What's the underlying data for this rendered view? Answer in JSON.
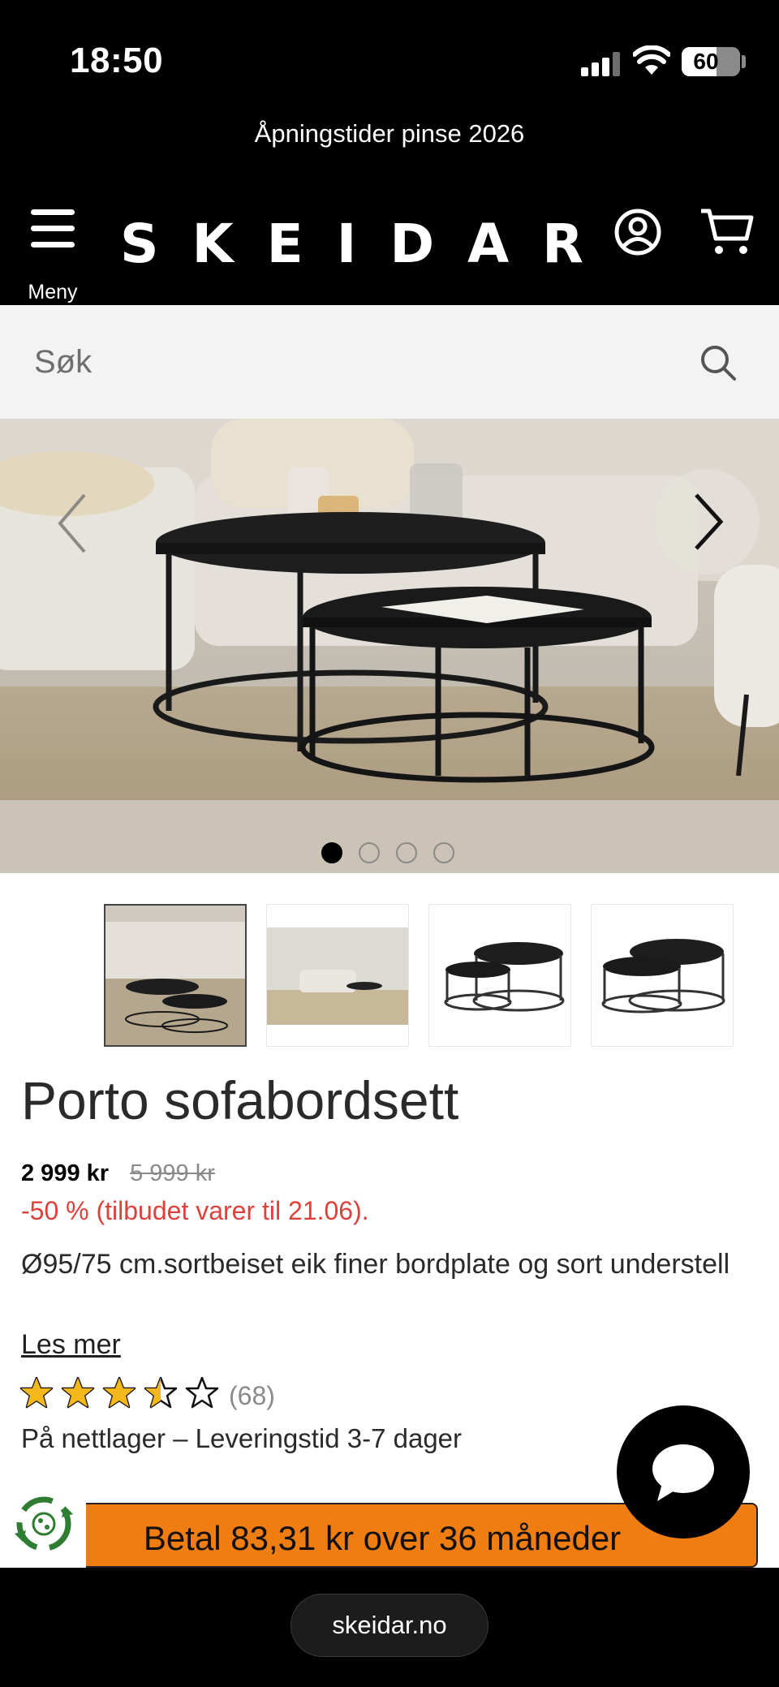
{
  "status_bar": {
    "time": "18:50",
    "battery": "60",
    "battery_level": 0.6
  },
  "promo_banner": "Åpningstider pinse 2026",
  "header": {
    "menu_label": "Meny",
    "logo": "SKEIDAR"
  },
  "search": {
    "placeholder": "Søk"
  },
  "gallery": {
    "slide_count": 4,
    "active_slide": 1,
    "thumbnail_count": 4,
    "active_thumbnail": 1
  },
  "product": {
    "title": "Porto sofabordsett",
    "price": "2 999 kr",
    "old_price": "5 999 kr",
    "discount_text": "-50 % (tilbudet varer til 21.06).",
    "description": "Ø95/75 cm.sortbeiset eik finer bordplate og sort understell",
    "read_more": "Les mer",
    "rating": 3.5,
    "rating_max": 5,
    "review_count": "(68)",
    "stock": "På nettlager – Leveringstid 3-7 dager"
  },
  "installment": {
    "label": "Betal 83,31 kr over 36 måneder"
  },
  "browser": {
    "url": "skeidar.no"
  },
  "colors": {
    "header_bg": "#000000",
    "search_bg": "#f3f3f3",
    "discount_red": "#e0403a",
    "star_yellow": "#f5b81c",
    "installment_orange": "#ef7d12",
    "recycle_green": "#2e7d32"
  },
  "icons": {
    "menu": "hamburger-icon",
    "account": "user-icon",
    "cart": "cart-icon",
    "search": "search-icon",
    "prev": "chevron-left-icon",
    "next": "chevron-right-icon",
    "chat": "chat-bubble-icon",
    "recycle": "recycle-icon"
  }
}
